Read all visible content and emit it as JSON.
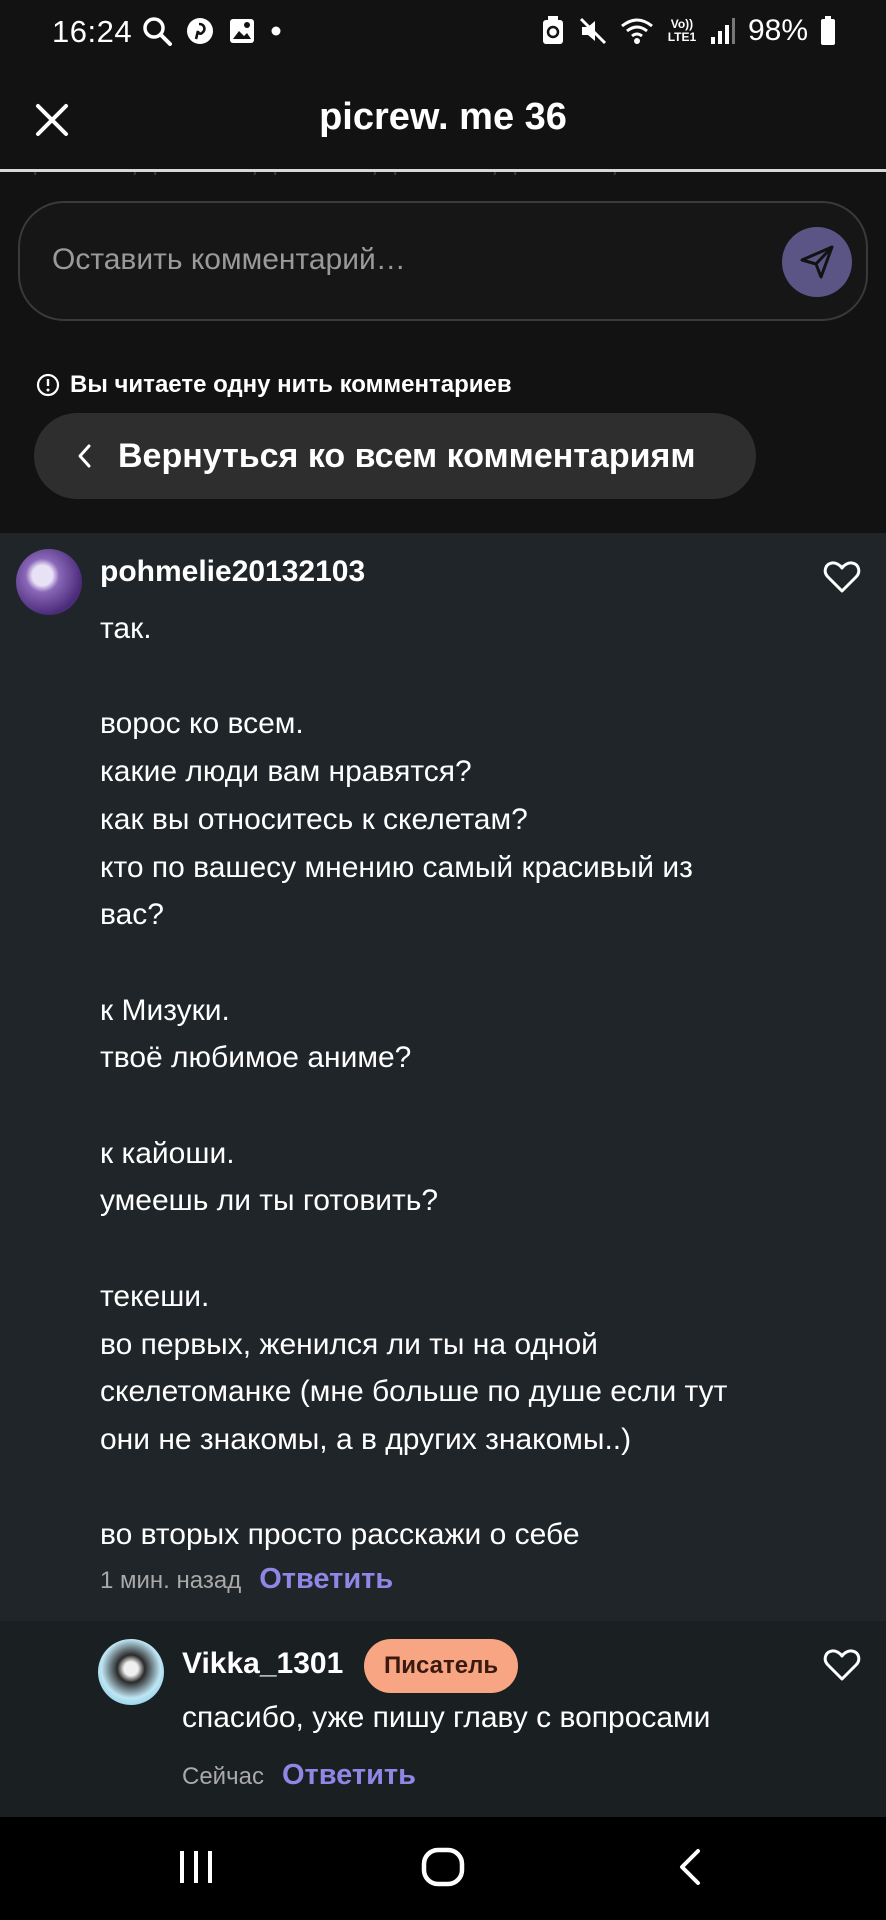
{
  "status_bar": {
    "time": "16:24",
    "battery": "98%",
    "left_icons": [
      "search-icon",
      "pinterest-icon",
      "gallery-icon",
      "dot-icon"
    ],
    "right_icons": [
      "recycle-icon",
      "mute-icon",
      "wifi-icon",
      "volte-icon",
      "signal-icon",
      "battery-icon"
    ],
    "volte_label": "Vo)) LTE1"
  },
  "header": {
    "title": "picrew. me 36",
    "close_icon": "close-icon"
  },
  "comment_input": {
    "placeholder": "Оставить комментарий…",
    "send_icon": "send-icon"
  },
  "thread": {
    "notice": "Вы читаете одну нить комментариев",
    "back_label": "Вернуться ко всем комментариям"
  },
  "comments": {
    "main": {
      "username": "pohmelie20132103",
      "body": "так.\n\nворос ко всем.\nкакие люди вам нравятся?\nкак вы относитесь к скелетам?\nкто по вашесу мнению самый красивый из\nвас?\n\nк Мизуки.\nтвоё любимое аниме?\n\nк кайоши.\nумеешь ли ты готовить?\n\nтекеши.\nво первых, женился ли ты на одной\nскелетоманке (мне больше по душе если тут\nони не знакомы, а в других знакомы..)\n\nво вторых просто расскажи о себе",
      "time": "1 мин. назад",
      "reply_label": "Ответить"
    },
    "reply": {
      "username": "Vikka_1301",
      "badge": "Писатель",
      "body": "спасибо, уже пишу главу с вопросами",
      "time": "Сейчас",
      "reply_label": "Ответить"
    }
  },
  "colors": {
    "background": "#121212",
    "comments_bg": "#1f2528",
    "accent": "#8f86e6",
    "badge": "#f7a583",
    "send_button": "#5a5585"
  },
  "nav_bar": {
    "icons": [
      "recents-icon",
      "home-icon",
      "back-icon"
    ]
  }
}
